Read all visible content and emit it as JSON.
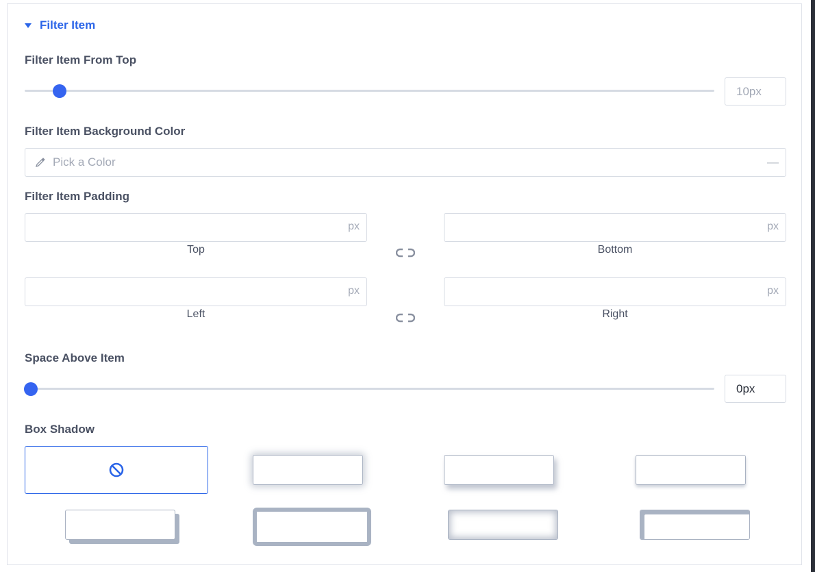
{
  "section": {
    "title": "Filter Item"
  },
  "from_top": {
    "label": "Filter Item From Top",
    "value": "10px",
    "slider_fraction": 0.042
  },
  "bg_color": {
    "label": "Filter Item Background Color",
    "placeholder": "Pick a Color",
    "clear": "—"
  },
  "padding": {
    "label": "Filter Item Padding",
    "unit": "px",
    "top": "Top",
    "bottom": "Bottom",
    "left": "Left",
    "right": "Right"
  },
  "space_above": {
    "label": "Space Above Item",
    "value": "0px",
    "slider_fraction": 0.0
  },
  "box_shadow": {
    "label": "Box Shadow",
    "options": [
      "none",
      "soft-glow",
      "bottom-right",
      "bottom",
      "offset-solid",
      "thick-border",
      "inset",
      "offset-top-left"
    ],
    "selected": "none"
  },
  "colors": {
    "accent": "#2b65e8",
    "thumb": "#3564f0",
    "border": "#d6dbe3",
    "label": "#4a5163"
  }
}
